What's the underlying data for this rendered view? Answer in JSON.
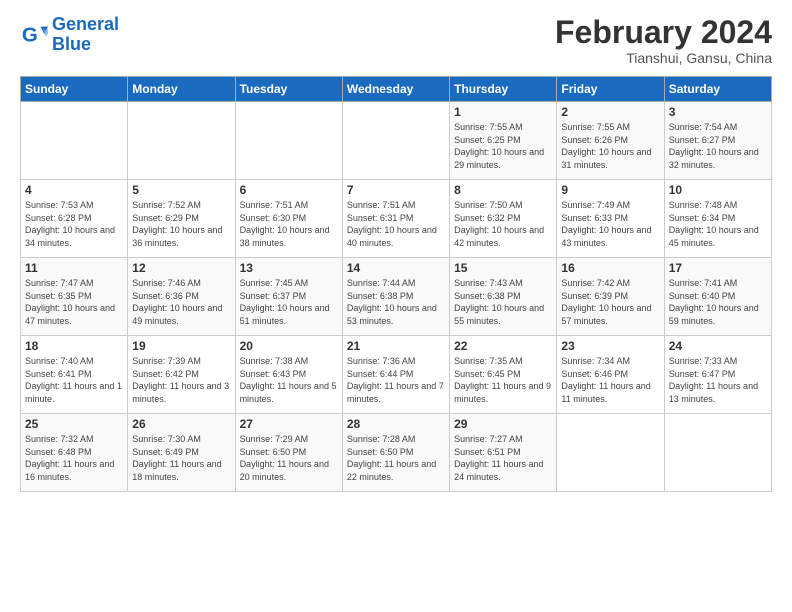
{
  "logo": {
    "line1": "General",
    "line2": "Blue"
  },
  "title": "February 2024",
  "subtitle": "Tianshui, Gansu, China",
  "days_of_week": [
    "Sunday",
    "Monday",
    "Tuesday",
    "Wednesday",
    "Thursday",
    "Friday",
    "Saturday"
  ],
  "weeks": [
    [
      {
        "day": "",
        "info": ""
      },
      {
        "day": "",
        "info": ""
      },
      {
        "day": "",
        "info": ""
      },
      {
        "day": "",
        "info": ""
      },
      {
        "day": "1",
        "info": "Sunrise: 7:55 AM\nSunset: 6:25 PM\nDaylight: 10 hours and 29 minutes."
      },
      {
        "day": "2",
        "info": "Sunrise: 7:55 AM\nSunset: 6:26 PM\nDaylight: 10 hours and 31 minutes."
      },
      {
        "day": "3",
        "info": "Sunrise: 7:54 AM\nSunset: 6:27 PM\nDaylight: 10 hours and 32 minutes."
      }
    ],
    [
      {
        "day": "4",
        "info": "Sunrise: 7:53 AM\nSunset: 6:28 PM\nDaylight: 10 hours and 34 minutes."
      },
      {
        "day": "5",
        "info": "Sunrise: 7:52 AM\nSunset: 6:29 PM\nDaylight: 10 hours and 36 minutes."
      },
      {
        "day": "6",
        "info": "Sunrise: 7:51 AM\nSunset: 6:30 PM\nDaylight: 10 hours and 38 minutes."
      },
      {
        "day": "7",
        "info": "Sunrise: 7:51 AM\nSunset: 6:31 PM\nDaylight: 10 hours and 40 minutes."
      },
      {
        "day": "8",
        "info": "Sunrise: 7:50 AM\nSunset: 6:32 PM\nDaylight: 10 hours and 42 minutes."
      },
      {
        "day": "9",
        "info": "Sunrise: 7:49 AM\nSunset: 6:33 PM\nDaylight: 10 hours and 43 minutes."
      },
      {
        "day": "10",
        "info": "Sunrise: 7:48 AM\nSunset: 6:34 PM\nDaylight: 10 hours and 45 minutes."
      }
    ],
    [
      {
        "day": "11",
        "info": "Sunrise: 7:47 AM\nSunset: 6:35 PM\nDaylight: 10 hours and 47 minutes."
      },
      {
        "day": "12",
        "info": "Sunrise: 7:46 AM\nSunset: 6:36 PM\nDaylight: 10 hours and 49 minutes."
      },
      {
        "day": "13",
        "info": "Sunrise: 7:45 AM\nSunset: 6:37 PM\nDaylight: 10 hours and 51 minutes."
      },
      {
        "day": "14",
        "info": "Sunrise: 7:44 AM\nSunset: 6:38 PM\nDaylight: 10 hours and 53 minutes."
      },
      {
        "day": "15",
        "info": "Sunrise: 7:43 AM\nSunset: 6:38 PM\nDaylight: 10 hours and 55 minutes."
      },
      {
        "day": "16",
        "info": "Sunrise: 7:42 AM\nSunset: 6:39 PM\nDaylight: 10 hours and 57 minutes."
      },
      {
        "day": "17",
        "info": "Sunrise: 7:41 AM\nSunset: 6:40 PM\nDaylight: 10 hours and 59 minutes."
      }
    ],
    [
      {
        "day": "18",
        "info": "Sunrise: 7:40 AM\nSunset: 6:41 PM\nDaylight: 11 hours and 1 minute."
      },
      {
        "day": "19",
        "info": "Sunrise: 7:39 AM\nSunset: 6:42 PM\nDaylight: 11 hours and 3 minutes."
      },
      {
        "day": "20",
        "info": "Sunrise: 7:38 AM\nSunset: 6:43 PM\nDaylight: 11 hours and 5 minutes."
      },
      {
        "day": "21",
        "info": "Sunrise: 7:36 AM\nSunset: 6:44 PM\nDaylight: 11 hours and 7 minutes."
      },
      {
        "day": "22",
        "info": "Sunrise: 7:35 AM\nSunset: 6:45 PM\nDaylight: 11 hours and 9 minutes."
      },
      {
        "day": "23",
        "info": "Sunrise: 7:34 AM\nSunset: 6:46 PM\nDaylight: 11 hours and 11 minutes."
      },
      {
        "day": "24",
        "info": "Sunrise: 7:33 AM\nSunset: 6:47 PM\nDaylight: 11 hours and 13 minutes."
      }
    ],
    [
      {
        "day": "25",
        "info": "Sunrise: 7:32 AM\nSunset: 6:48 PM\nDaylight: 11 hours and 16 minutes."
      },
      {
        "day": "26",
        "info": "Sunrise: 7:30 AM\nSunset: 6:49 PM\nDaylight: 11 hours and 18 minutes."
      },
      {
        "day": "27",
        "info": "Sunrise: 7:29 AM\nSunset: 6:50 PM\nDaylight: 11 hours and 20 minutes."
      },
      {
        "day": "28",
        "info": "Sunrise: 7:28 AM\nSunset: 6:50 PM\nDaylight: 11 hours and 22 minutes."
      },
      {
        "day": "29",
        "info": "Sunrise: 7:27 AM\nSunset: 6:51 PM\nDaylight: 11 hours and 24 minutes."
      },
      {
        "day": "",
        "info": ""
      },
      {
        "day": "",
        "info": ""
      }
    ]
  ]
}
